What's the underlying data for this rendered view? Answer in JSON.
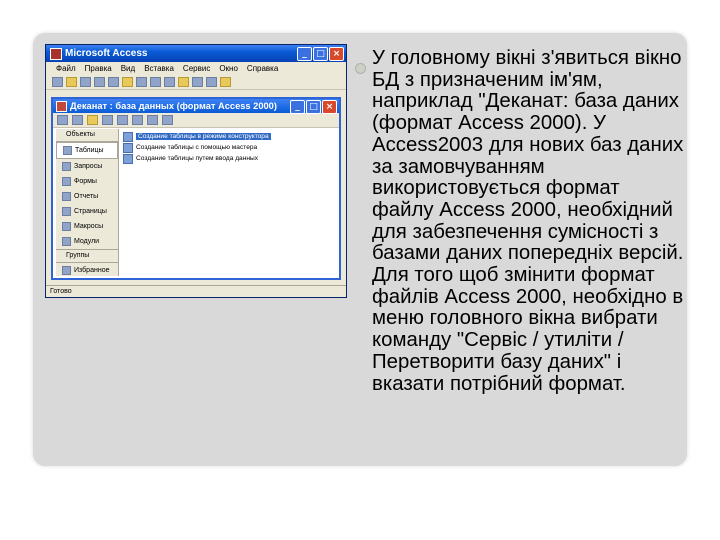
{
  "slide": {
    "bullet_text": "У головному вікні з'явиться вікно БД з призначеним ім'ям, наприклад \"Деканат: база даних (формат Access 2000). У Access2003 для нових баз даних за замовчуванням використовується формат файлу Access 2000, необхідний для забезпечення сумісності з базами даних попередніх версій. Для того щоб змінити формат файлів Access 2000, необхідно в меню головного вікна вибрати команду \"Сервіс / утиліти / Перетворити базу даних\" і вказати потрібний формат."
  },
  "screenshot": {
    "app_title": "Microsoft Access",
    "menu": [
      "Файл",
      "Правка",
      "Вид",
      "Вставка",
      "Сервис",
      "Окно",
      "Справка"
    ],
    "db_window_title": "Деканат : база данных (формат Access 2000)",
    "objects_header": "Объекты",
    "objects": [
      "Таблицы",
      "Запросы",
      "Формы",
      "Отчеты",
      "Страницы",
      "Макросы",
      "Модули"
    ],
    "groups_header": "Группы",
    "groups": [
      "Избранное"
    ],
    "list_items": [
      "Создание таблицы в режиме конструктора",
      "Создание таблицы с помощью мастера",
      "Создание таблицы путем ввода данных"
    ],
    "status": "Готово",
    "controls": {
      "minimize": "_",
      "maximize": "□",
      "close": "×"
    }
  }
}
